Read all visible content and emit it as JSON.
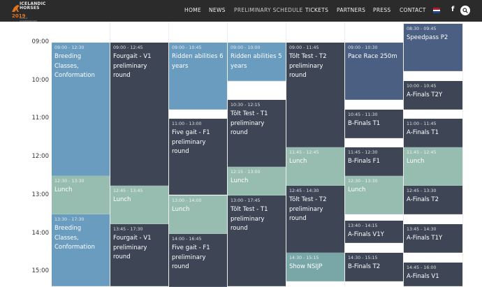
{
  "logo": {
    "line1": "ICELANDIC",
    "line2": "HORSES",
    "year": "2019",
    "subtitle": "WORLD CHAMPIONSHIPS"
  },
  "nav": [
    {
      "label": "HOME",
      "active": false
    },
    {
      "label": "NEWS",
      "active": false
    },
    {
      "label": "PRELIMINARY SCHEDULE",
      "active": true
    },
    {
      "label": "TICKETS",
      "active": false
    },
    {
      "label": "PARTNERS",
      "active": false
    },
    {
      "label": "PRESS",
      "active": false
    },
    {
      "label": "CONTACT",
      "active": false
    }
  ],
  "icons": {
    "flag": "netherlands-flag-icon",
    "facebook": "facebook-icon",
    "search": "search-icon"
  },
  "facebook_glyph": "f",
  "colors": {
    "topbar": "#2b2b2b",
    "blue": "#6a9cbf",
    "dark": "#3e4655",
    "green": "#97bcb0",
    "navy": "#4a5f82",
    "teal": "#79a7a8",
    "logo_accent": "#e0751e"
  },
  "time_labels": [
    "09:00",
    "10:00",
    "11:00",
    "12:00",
    "13:00",
    "14:00",
    "15:00"
  ],
  "columns": [
    [
      {
        "time": "09:00 - 12:30",
        "title": "Breeding Classes, Conformation",
        "color": "blue"
      },
      {
        "time": "12:30 - 13:30",
        "title": "Lunch",
        "color": "green"
      },
      {
        "time": "13:30 - 17:30",
        "title": "Breeding Classes, Conformation",
        "color": "blue"
      }
    ],
    [
      {
        "time": "09:00 - 12:45",
        "title": "Fourgait - V1 preliminary round",
        "color": "dark"
      },
      {
        "time": "12:45 - 13:45",
        "title": "Lunch",
        "color": "green"
      },
      {
        "time": "13:45 - 17:30",
        "title": "Fourgait - V1 preliminary round",
        "color": "dark"
      }
    ],
    [
      {
        "time": "09:00 - 10:45",
        "title": "Ridden abilities 6 years",
        "color": "blue"
      },
      {
        "time": "11:00 - 13:00",
        "title": "Five gait - F1 preliminary round",
        "color": "dark"
      },
      {
        "time": "13:00 - 14:00",
        "title": "Lunch",
        "color": "green"
      },
      {
        "time": "14:00 - 16:45",
        "title": "Five gait - F1 preliminary round",
        "color": "dark"
      }
    ],
    [
      {
        "time": "09:00 - 10:00",
        "title": "Ridden abilities 5 years",
        "color": "blue"
      },
      {
        "time": "10:30 - 12:15",
        "title": "Tölt Test - T1 preliminary round",
        "color": "dark"
      },
      {
        "time": "12:15 - 13:00",
        "title": "Lunch",
        "color": "green"
      },
      {
        "time": "13:00 - 17:45",
        "title": "Tölt Test - T1 preliminary round",
        "color": "dark"
      }
    ],
    [
      {
        "time": "09:00 - 11:45",
        "title": "Tölt Test - T2 preliminary round",
        "color": "dark"
      },
      {
        "time": "11:45 - 12:45",
        "title": "Lunch",
        "color": "green"
      },
      {
        "time": "12:45 - 14:30",
        "title": "Tölt Test - T2 preliminary round",
        "color": "dark"
      },
      {
        "time": "14:30 - 15:15",
        "title": "Show NSIJP",
        "color": "teal"
      }
    ],
    [
      {
        "time": "09:00 - 10:30",
        "title": "Pace Race 250m",
        "color": "navy"
      },
      {
        "time": "10:45 - 11:30",
        "title": "B-Finals T1",
        "color": "dark"
      },
      {
        "time": "11:45 - 12:30",
        "title": "B-Finals F1",
        "color": "dark"
      },
      {
        "time": "12:30 - 13:30",
        "title": "Lunch",
        "color": "green"
      },
      {
        "time": "13:40 - 14:15",
        "title": "A-Finals V1Y",
        "color": "dark"
      },
      {
        "time": "14:30 - 15:15",
        "title": "B-Finals T2",
        "color": "dark"
      }
    ],
    [
      {
        "time": "08:30 - 09:45",
        "title": "Speedpass P2",
        "color": "navy"
      },
      {
        "time": "10:00 - 10:45",
        "title": "A-Finals T2Y",
        "color": "dark"
      },
      {
        "time": "11:00 - 11:45",
        "title": "A-Finals T1",
        "color": "dark"
      },
      {
        "time": "11:45 - 12:45",
        "title": "Lunch",
        "color": "green"
      },
      {
        "time": "12:45 - 13:30",
        "title": "A-Finals T2",
        "color": "dark"
      },
      {
        "time": "13:45 - 14:30",
        "title": "A-Finals T1Y",
        "color": "dark"
      },
      {
        "time": "14:45 - 16:00",
        "title": "A-Finals V1",
        "color": "dark"
      }
    ]
  ]
}
